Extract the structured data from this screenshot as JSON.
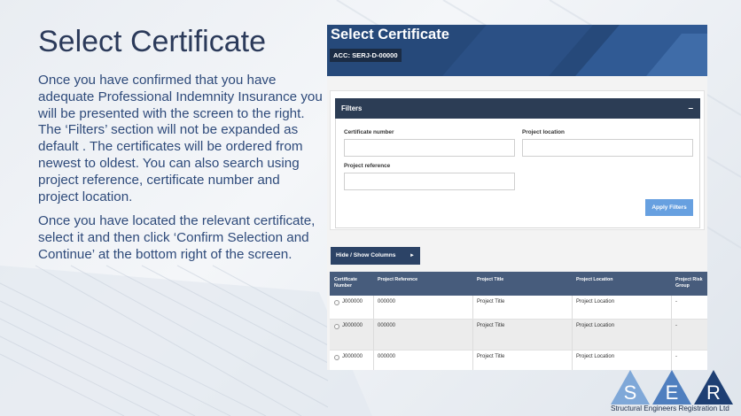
{
  "slide": {
    "title": "Select Certificate",
    "paragraph1": "Once you have confirmed that you have adequate Professional Indemnity Insurance  you will be presented with the screen to the right. The ‘Filters’ section will not be expanded as default . The certificates will be ordered from newest to oldest. You can also search using project reference, certificate number and project location.",
    "paragraph2": "Once you have located the relevant certificate, select it and then click ‘Confirm Selection and Continue’ at the bottom right of the screen."
  },
  "screen": {
    "header_title": "Select Certificate",
    "account_badge": "ACC: SERJ-D-00000",
    "filters": {
      "title": "Filters",
      "collapse_symbol": "–",
      "certificate_number_label": "Certificate number",
      "project_location_label": "Project location",
      "project_reference_label": "Project reference",
      "apply_label": "Apply Filters"
    },
    "hide_show_label": "Hide / Show Columns",
    "hide_show_arrow": "►",
    "table": {
      "columns": [
        "Certificate Number",
        "Project Reference",
        "Project Title",
        "Project Location",
        "Project Risk Group"
      ],
      "rows": [
        [
          "J000000",
          "000000",
          "Project Title",
          "Project Location",
          "-"
        ],
        [
          "J000000",
          "000000",
          "Project Title",
          "Project Location",
          "-"
        ],
        [
          "J000000",
          "000000",
          "Project Title",
          "Project Location",
          "-"
        ]
      ]
    }
  },
  "logo": {
    "letters": [
      "S",
      "E",
      "R"
    ],
    "caption": "Structural Engineers Registration Ltd"
  },
  "colors": {
    "title": "#2b3a5a",
    "body_text": "#2e4a7a",
    "header_blue": "#26497a",
    "filters_bar": "#2c3d55",
    "apply_button": "#67a0e0",
    "table_header": "#475c7c"
  }
}
